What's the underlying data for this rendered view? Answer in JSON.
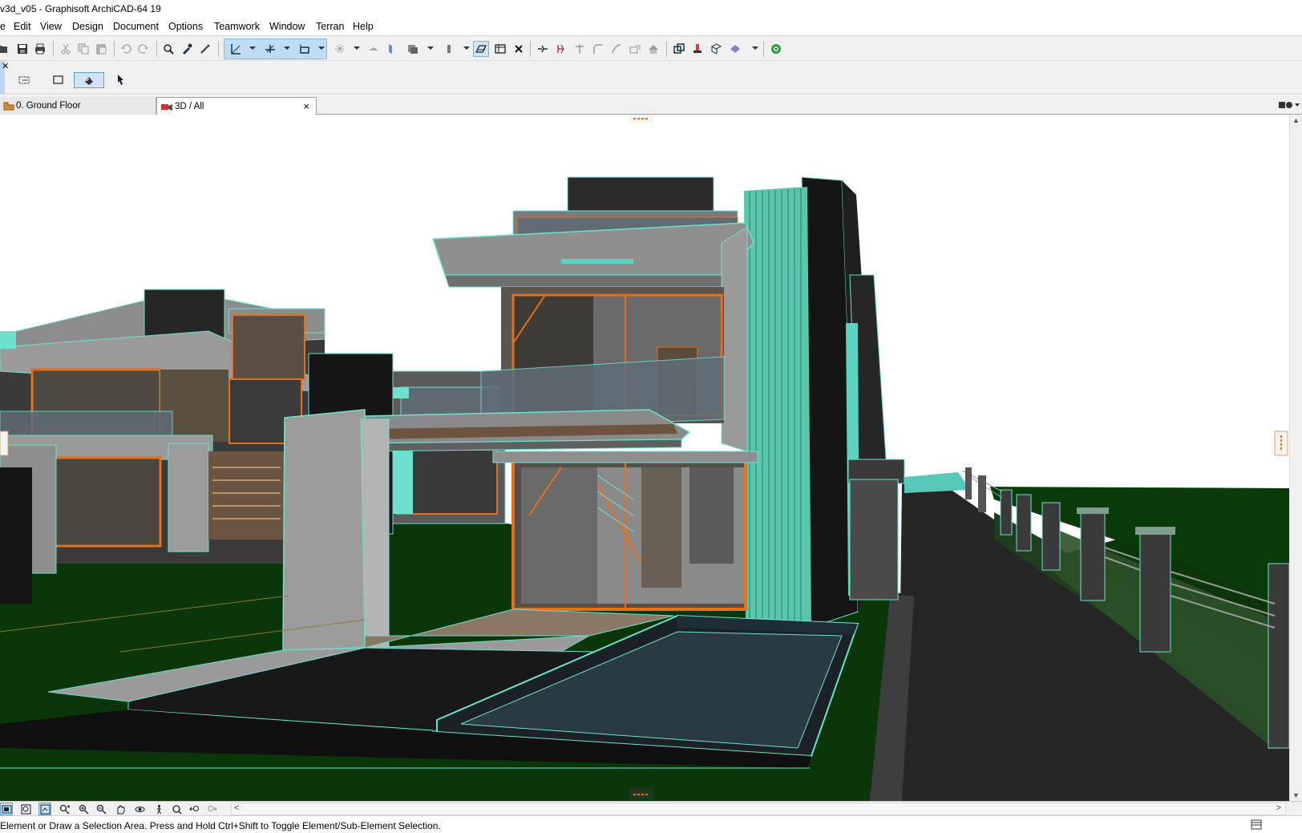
{
  "window": {
    "title": "v3d_v05 - Graphisoft ArchiCAD-64 19"
  },
  "menu": {
    "items": [
      "e",
      "Edit",
      "View",
      "Design",
      "Document",
      "Options",
      "Teamwork",
      "Window",
      "Terran",
      "Help"
    ]
  },
  "toolbar": {
    "icons": [
      "open-icon",
      "save-icon",
      "print-icon",
      "cut-icon",
      "copy-icon",
      "paste-icon",
      "undo-icon",
      "redo-icon",
      "find-select-icon",
      "eyedropper-icon",
      "syringe-icon",
      "snap-guides-icon",
      "grid-snap-icon",
      "cursor-snap-icon",
      "gravity-icon",
      "trace-icon",
      "layer-icon",
      "solid-operations-icon",
      "fill-icon",
      "marquee-3d-icon",
      "model-view-options-icon",
      "close-3d-icon",
      "split-icon",
      "adjust-icon",
      "intersect-icon",
      "fillet-icon",
      "offset-icon",
      "resize-icon",
      "roof-icon",
      "modify-icon",
      "curtain-wall-icon",
      "profile-icon",
      "render-icon",
      "globe-icon"
    ]
  },
  "toolbox": {
    "icons": [
      "marquee-icon",
      "selection-rect-icon",
      "3d-cursor-icon",
      "arrow-tool-icon"
    ]
  },
  "tabs": [
    {
      "label": "0. Ground Floor",
      "icon": "floor-plan-icon"
    },
    {
      "label": "3D / All",
      "icon": "3d-camera-icon",
      "close": "×"
    }
  ],
  "navigator": {
    "icons": [
      "fit-window-icon",
      "zoom-icon",
      "navigation-icon",
      "zoom-in-area-icon",
      "zoom-in-icon",
      "zoom-out-icon",
      "pan-icon",
      "orbit-icon",
      "explore-icon",
      "fit-in-icon",
      "previous-zoom-icon",
      "next-zoom-icon"
    ]
  },
  "scrollbar": {
    "left": "<",
    "right": ">",
    "up": "▲",
    "down": "▼"
  },
  "status": {
    "text": "Element or Draw a Selection Area. Press and Hold Ctrl+Shift to Toggle Element/Sub-Element Selection."
  },
  "colors": {
    "accent": "#0078d7",
    "grass": "#0b3a0b",
    "concrete": "#8c8c8c",
    "edge": "#6fe0d0",
    "frame": "#e86f18",
    "dark": "#1b1b1b"
  }
}
